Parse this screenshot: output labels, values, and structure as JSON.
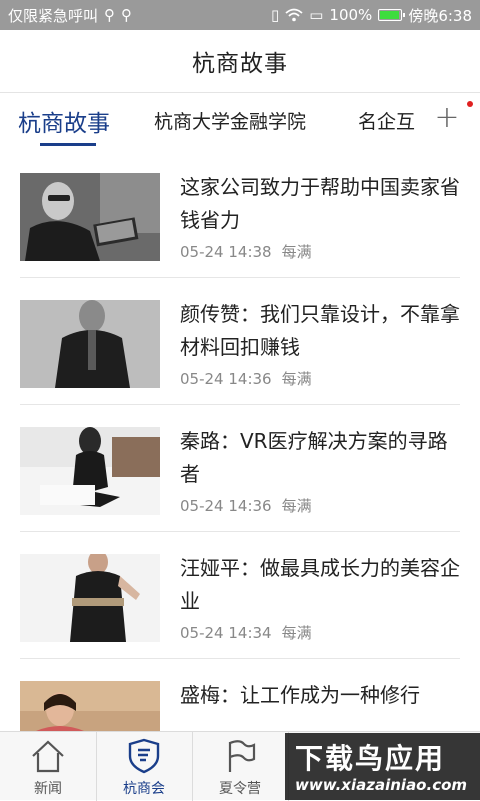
{
  "status_bar": {
    "left_text": "仅限紧急呼叫",
    "battery": "100%",
    "time": "傍晚6:38",
    "battery_level": 1.0
  },
  "header": {
    "title": "杭商故事"
  },
  "tabs": [
    {
      "label": "杭商故事",
      "active": true
    },
    {
      "label": "杭商大学金融学院",
      "active": false
    },
    {
      "label": "名企互",
      "active": false
    }
  ],
  "tabs_add_icon": "plus-icon",
  "articles": [
    {
      "title": "这家公司致力于帮助中国卖家省钱省力",
      "date": "05-24 14:38",
      "source": "每满"
    },
    {
      "title": "颜传赞：我们只靠设计，不靠拿材料回扣赚钱",
      "date": "05-24 14:36",
      "source": "每满"
    },
    {
      "title": "秦路：VR医疗解决方案的寻路者",
      "date": "05-24 14:36",
      "source": "每满"
    },
    {
      "title": "汪娅平：做最具成长力的美容企业",
      "date": "05-24 14:34",
      "source": "每满"
    },
    {
      "title": "盛梅：让工作成为一种修行",
      "date": "",
      "source": ""
    }
  ],
  "bottom_nav": [
    {
      "label": "新闻",
      "icon": "home-icon",
      "active": false
    },
    {
      "label": "杭商会",
      "icon": "shield-icon",
      "active": true
    },
    {
      "label": "夏令营",
      "icon": "flag-icon",
      "active": false
    }
  ],
  "watermark": {
    "line1": "下载鸟应用",
    "line2": "www.xiazainiao.com"
  },
  "colors": {
    "accent": "#1a3e8a",
    "status_bar": "#9a9a9a",
    "badge": "#e02020"
  }
}
